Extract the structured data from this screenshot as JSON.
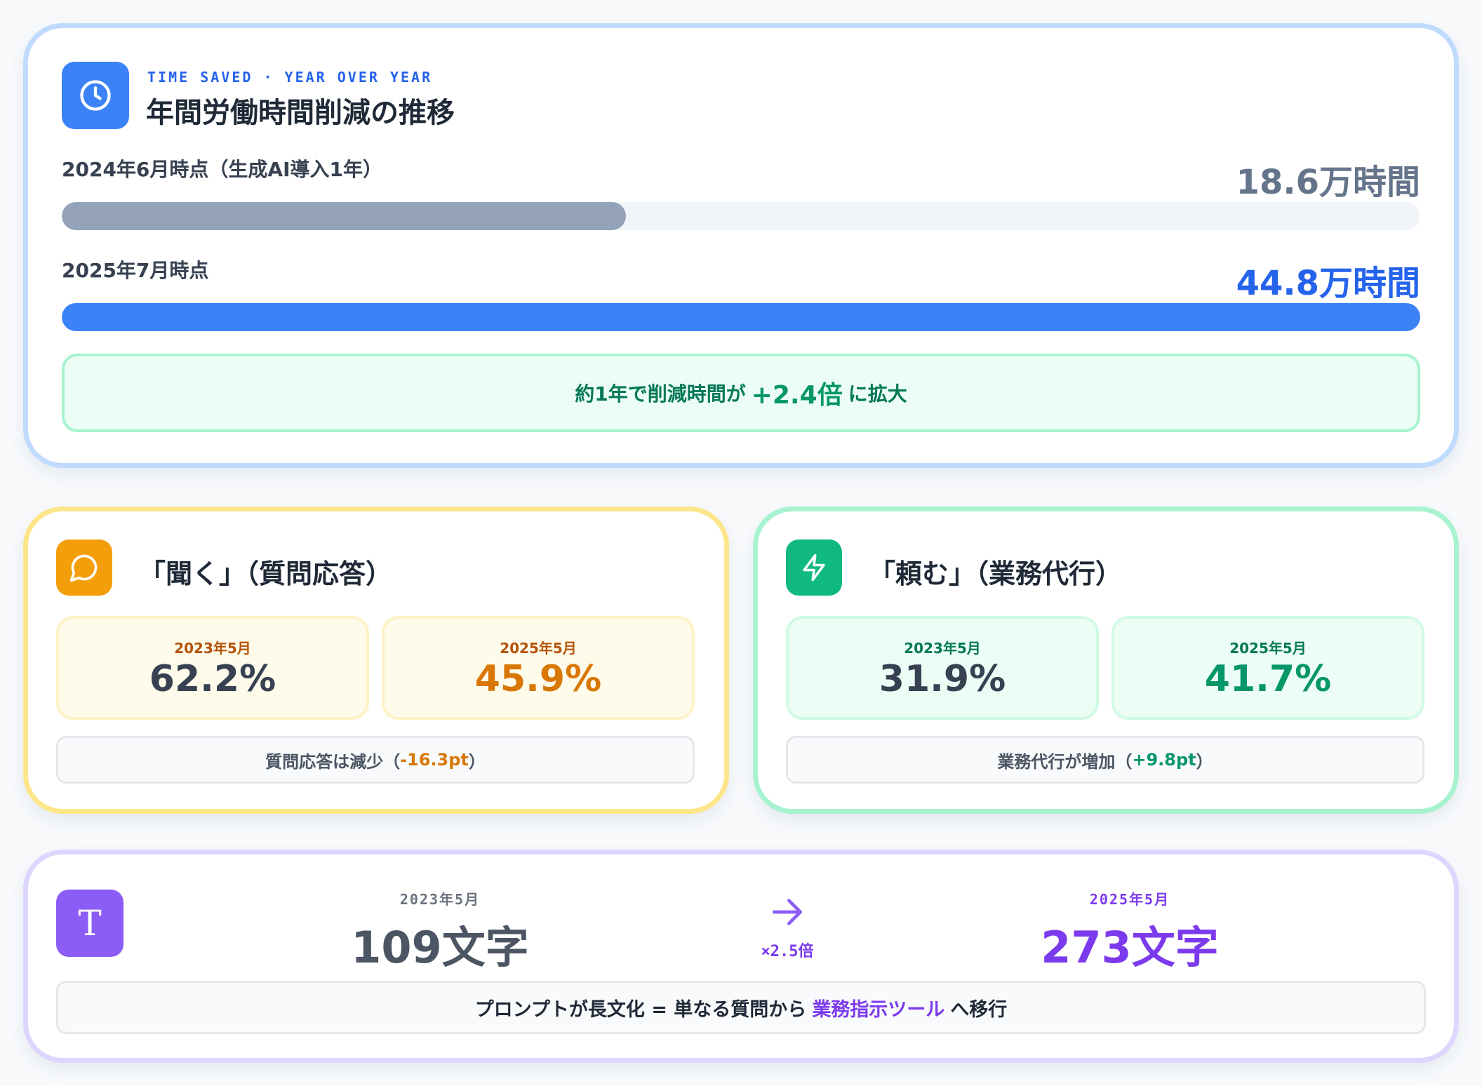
{
  "time_card": {
    "kicker": "TIME SAVED · YEAR OVER YEAR",
    "title": "年間労働時間削減の推移",
    "icon": "clock-icon",
    "rows": [
      {
        "label": "2024年6月時点（生成AI導入1年）",
        "value": "18.6万時間",
        "hours": 18.6
      },
      {
        "label": "2025年7月時点",
        "value": "44.8万時間",
        "hours": 44.8
      }
    ],
    "summary_prefix": "約1年で削減時間が",
    "summary_highlight": "+2.4倍",
    "summary_suffix": "に拡大"
  },
  "ask_card": {
    "icon": "chat-bubble-icon",
    "title": "「聞く」（質問応答）",
    "before": {
      "date": "2023年5月",
      "value": "62.2%"
    },
    "after": {
      "date": "2025年5月",
      "value": "45.9%"
    },
    "note_prefix": "質問応答は減少（",
    "note_delta": "-16.3pt",
    "note_suffix": "）"
  },
  "request_card": {
    "icon": "lightning-icon",
    "title": "「頼む」（業務代行）",
    "before": {
      "date": "2023年5月",
      "value": "31.9%"
    },
    "after": {
      "date": "2025年5月",
      "value": "41.7%"
    },
    "note_prefix": "業務代行が増加（",
    "note_delta": "+9.8pt",
    "note_suffix": "）"
  },
  "length_card": {
    "icon": "text-icon",
    "icon_glyph": "T",
    "before": {
      "date": "2023年5月",
      "value": "109文字"
    },
    "after": {
      "date": "2025年5月",
      "value": "273文字"
    },
    "ratio": "×2.5倍",
    "summary_prefix": "プロンプトが長文化 = 単なる質問から",
    "summary_highlight": "業務指示ツール",
    "summary_suffix": "へ移行"
  },
  "colors": {
    "blue": "#3b82f6",
    "gray_bar": "#94a3b8",
    "amber": "#f59e0b",
    "green": "#10b981",
    "purple": "#8b5cf6"
  }
}
